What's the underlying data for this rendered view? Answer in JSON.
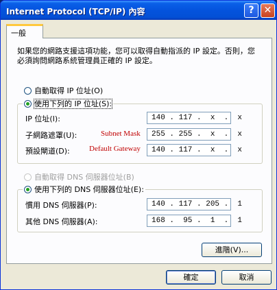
{
  "window": {
    "title": "Internet Protocol (TCP/IP) 內容",
    "help_label": "?",
    "close_label": "✕"
  },
  "tabs": [
    {
      "label": "一般"
    }
  ],
  "description": "如果您的網路支援這項功能，您可以取得自動指派的 IP 設定。否則，您必須詢問網路系統管理員正確的 IP 設定。",
  "ip_section": {
    "auto_label": "自動取得 IP 位址(O)",
    "manual_label": "使用下列的 IP 位址(S):",
    "fields": [
      {
        "label": "IP 位址(I):",
        "annotation": "",
        "value": "140 . 117 .  x  .  x"
      },
      {
        "label": "子網路遮罩(U):",
        "annotation": "Subnet Mask",
        "value": "255 . 255 .  x  .  x"
      },
      {
        "label": "預設閘道(D):",
        "annotation": "Default Gateway",
        "value": "140 . 117 .  x  .  x"
      }
    ]
  },
  "dns_section": {
    "auto_label": "自動取得 DNS 伺服器位址(B)",
    "manual_label": "使用下列的 DNS 伺服器位址(E):",
    "fields": [
      {
        "label": "慣用 DNS 伺服器(P):",
        "value": "140 . 117 . 205 .  1"
      },
      {
        "label": "其他 DNS 伺服器(A):",
        "value": "168 .  95 .  1  .  1"
      }
    ]
  },
  "buttons": {
    "advanced": "進階(V)...",
    "ok": "確定",
    "cancel": "取消"
  },
  "colors": {
    "annotation": "#c00000",
    "title_bar": "#0453dd",
    "radio_checked": "#21a121"
  }
}
